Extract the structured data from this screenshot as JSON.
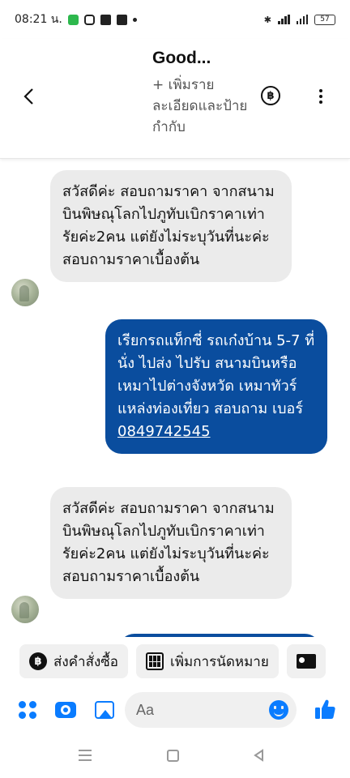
{
  "status_bar": {
    "time": "08:21 น.",
    "battery": "57"
  },
  "header": {
    "title": "Good...",
    "subtitle": "+ เพิ่มรายละเอียดและป้ายกำกับ",
    "baht_symbol": "฿"
  },
  "messages": [
    {
      "direction": "incoming",
      "text": "สวัสดีค่ะ สอบถามราคา จากสนามบินพิษณุโลกไปภูทับเบิกราคาเท่ารัยค่ะ2คน แต่ยังไม่ระบุวันที่นะค่ะ สอบถามราคาเบื้องต้น"
    },
    {
      "direction": "outgoing",
      "text": "เรียกรถแท็กซี่ รถเก๋งบ้าน 5-7 ที่นั่ง ไปส่ง ไปรับ สนามบินหรือเหมาไปต่างจังหวัด เหมาทัวร์ แหล่งท่องเที่ยว สอบถาม เบอร์",
      "phone": "0849742545"
    },
    {
      "direction": "incoming",
      "text": "สวัสดีค่ะ สอบถามราคา จากสนามบินพิษณุโลกไปภูทับเบิกราคาเท่ารัยค่ะ2คน แต่ยังไม่ระบุวันที่นะค่ะ สอบถามราคาเบื้องต้น"
    }
  ],
  "quick_actions": {
    "order_label": "ส่งคำสั่งซื้อ",
    "appointment_label": "เพิ่มการนัดหมาย"
  },
  "composer": {
    "placeholder": "Aa"
  },
  "colors": {
    "outgoing_bubble": "#0a4d9e",
    "incoming_bubble": "#ebebeb",
    "accent": "#0a7cff"
  },
  "icons": [
    "back-icon",
    "baht-icon",
    "more-icon",
    "apps-icon",
    "camera-icon",
    "image-icon",
    "emoji-icon",
    "like-icon",
    "calendar-icon",
    "contact-card-icon"
  ]
}
